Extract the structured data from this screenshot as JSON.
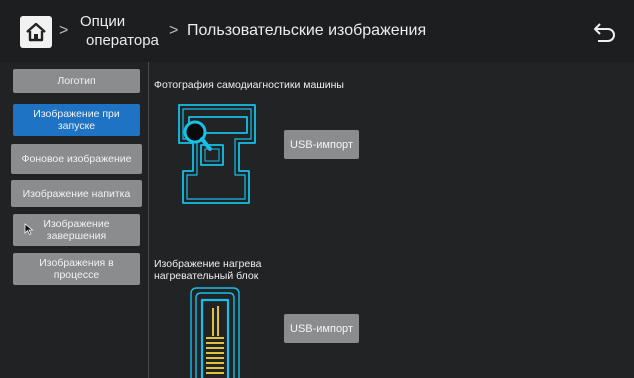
{
  "header": {
    "breadcrumb_1_line1": "Опции",
    "breadcrumb_1_line2": "оператора",
    "breadcrumb_2": "Пользовательские изображения",
    "separator": ">"
  },
  "sidebar": {
    "items": [
      {
        "label": "Логотип",
        "active": false
      },
      {
        "label": "Изображение при запуске",
        "active": true
      },
      {
        "label": "Фоновое изображение",
        "active": false
      },
      {
        "label": "Изображение напитка",
        "active": false
      },
      {
        "label": "Изображение завершения",
        "active": false
      },
      {
        "label": "Изображения в процессе",
        "active": false
      }
    ]
  },
  "main": {
    "section_1": {
      "title": "Фотография самодиагностики машины",
      "button_label": "USB-импорт"
    },
    "section_2": {
      "title_line1": "Изображение нагрева",
      "title_line2": "нагревательный блок",
      "button_label": "USB-импорт"
    }
  },
  "colors": {
    "background": "#222325",
    "active_item": "#1e73c4",
    "button_gray": "#8b8c8e",
    "icon_cyan": "#16c0e8",
    "heater_yellow": "#e0c13a"
  },
  "icons": {
    "home": "home-icon",
    "back": "back-arrow-icon",
    "machine_diagnostics": "coffee-machine-magnifier-icon",
    "heating_block": "heating-block-icon"
  }
}
